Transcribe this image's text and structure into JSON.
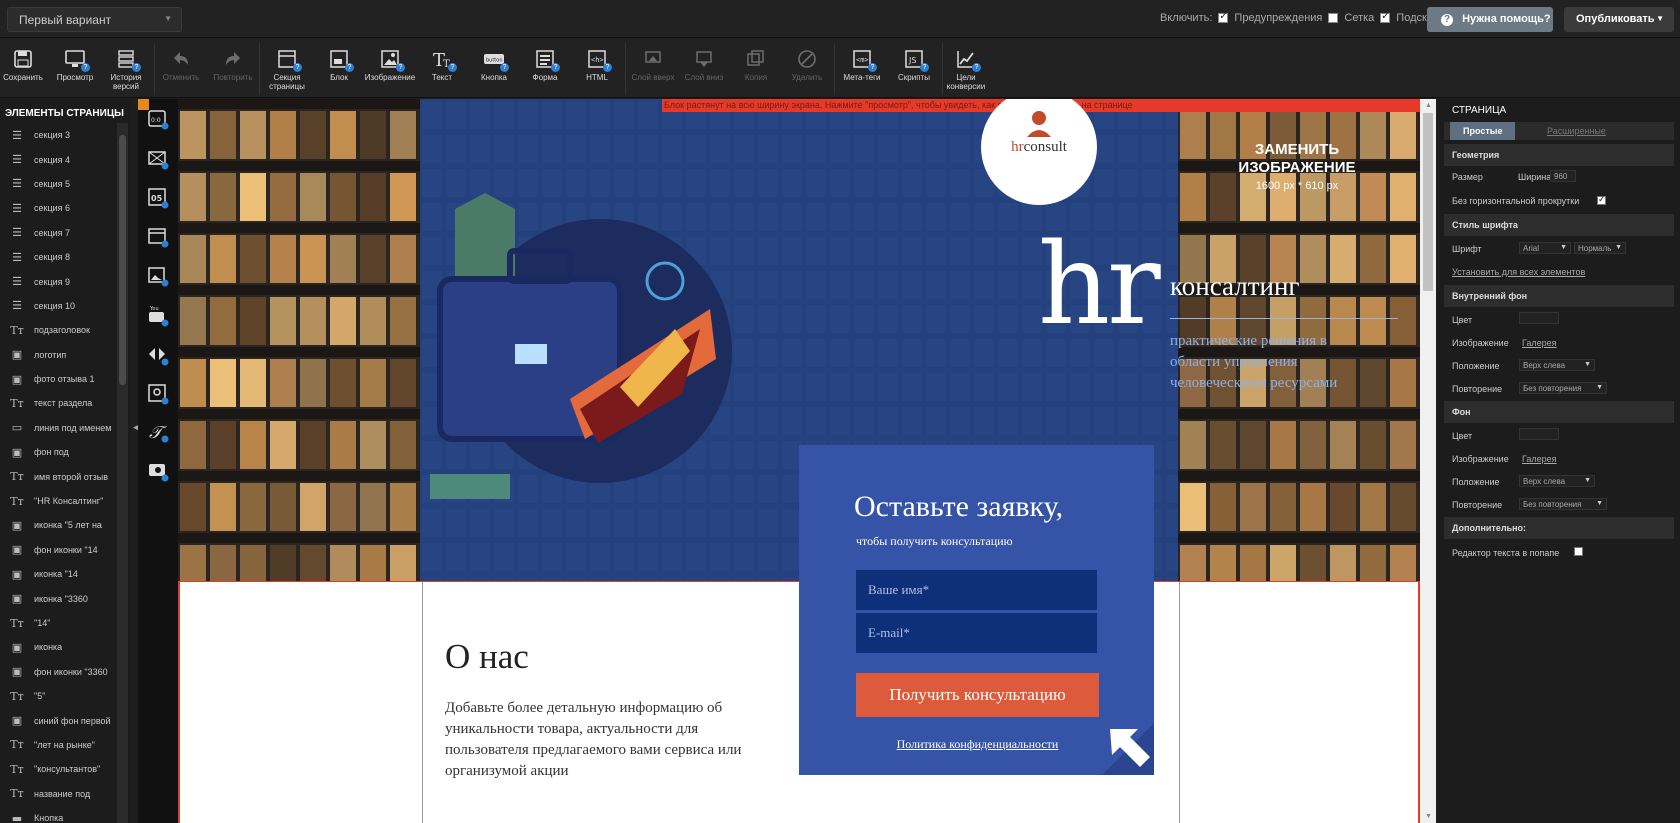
{
  "topbar": {
    "variant": "Первый вариант",
    "enable_label": "Включить:",
    "warnings_label": "Предупреждения",
    "grid_label": "Сетка",
    "hints_label": "Подсказки",
    "help_label": "Нужна помощь?",
    "publish_label": "Опубликовать"
  },
  "toolbar": {
    "save": "Сохранить",
    "preview": "Просмотр",
    "history": "История версий",
    "undo": "Отменить",
    "redo": "Повторить",
    "page_section": "Секция страницы",
    "block": "Блок",
    "image": "Изображение",
    "text": "Текст",
    "button": "Кнопка",
    "form": "Форма",
    "html": "HTML",
    "layer_up": "Слой вверх",
    "layer_down": "Слой вниз",
    "copy": "Копия",
    "delete": "Удалить",
    "meta_tags": "Мета-теги",
    "scripts": "Скрипты",
    "conversion_goals": "Цели конверсии"
  },
  "elements_panel": {
    "title": "ЭЛЕМЕНТЫ СТРАНИЦЫ",
    "items": [
      {
        "label": "секция 3",
        "icon": "section-icon"
      },
      {
        "label": "секция 4",
        "icon": "section-icon"
      },
      {
        "label": "секция 5",
        "icon": "section-icon"
      },
      {
        "label": "секция 6",
        "icon": "section-icon"
      },
      {
        "label": "секция 7",
        "icon": "section-icon"
      },
      {
        "label": "секция 8",
        "icon": "section-icon"
      },
      {
        "label": "секция 9",
        "icon": "section-icon"
      },
      {
        "label": "секция 10",
        "icon": "section-icon"
      },
      {
        "label": "подзаголовок",
        "icon": "text-icon"
      },
      {
        "label": "логотип",
        "icon": "image-icon"
      },
      {
        "label": "фото отзыва 1",
        "icon": "image-icon"
      },
      {
        "label": "текст раздела",
        "icon": "text-icon"
      },
      {
        "label": "линия под именем",
        "icon": "line-icon"
      },
      {
        "label": "фон под",
        "icon": "image-icon"
      },
      {
        "label": "имя второй отзыв",
        "icon": "text-icon"
      },
      {
        "label": "\"HR Консалтинг\"",
        "icon": "text-icon"
      },
      {
        "label": "иконка \"5 лет на",
        "icon": "image-icon"
      },
      {
        "label": "фон иконки \"14",
        "icon": "image-icon"
      },
      {
        "label": "иконка \"14",
        "icon": "image-icon"
      },
      {
        "label": "иконка \"3360",
        "icon": "image-icon"
      },
      {
        "label": "\"14\"",
        "icon": "text-icon"
      },
      {
        "label": "иконка",
        "icon": "image-icon"
      },
      {
        "label": "фон иконки \"3360",
        "icon": "image-icon"
      },
      {
        "label": "\"5\"",
        "icon": "text-icon"
      },
      {
        "label": "синий фон первой",
        "icon": "image-icon"
      },
      {
        "label": "\"лет на рынке\"",
        "icon": "text-icon"
      },
      {
        "label": "\"консультантов\"",
        "icon": "text-icon"
      },
      {
        "label": "название под",
        "icon": "text-icon"
      },
      {
        "label": "Кнопка",
        "icon": "button-icon"
      }
    ]
  },
  "canvas": {
    "full_width_notice": "Блок растянут на всю ширину экрана. Нажмите \"просмотр\", чтобы увидеть, как он будет выглядеть на странице",
    "logo_hr": "hr",
    "logo_consult": "consult",
    "replace_image_1": "ЗАМЕНИТЬ",
    "replace_image_2": "ИЗОБРАЖЕНИЕ",
    "replace_size": "1600 px * 610 px",
    "hr_big": "hr",
    "consulting": "консалтинг",
    "tagline": "практические решения в области управления человеческими ресурсами",
    "form_title": "Оставьте заявку,",
    "form_subtitle": "чтобы получить консультацию",
    "name_placeholder": "Ваше имя*",
    "email_placeholder": "E-mail*",
    "submit": "Получить консультацию",
    "privacy": "Политика конфиденциальности",
    "about_title": "О нас",
    "about_text": "Добавьте более детальную информацию об уникальности товара, актуальности для пользователя предлагаемого вами сервиса или организумой акции"
  },
  "right_panel": {
    "title": "СТРАНИЦА",
    "tab_simple": "Простые",
    "tab_advanced": "Расширенные",
    "geometry": "Геометрия",
    "size_label": "Размер",
    "width_label": "Ширина",
    "width_value": "960",
    "no_hscroll": "Без горизонтальной прокрутки",
    "font_style": "Стиль шрифта",
    "font_label": "Шрифт",
    "font_value": "Arial",
    "font_weight": "Нормаль",
    "apply_all": "Установить для всех элементов",
    "inner_bg": "Внутренний фон",
    "color_label": "Цвет",
    "image_label": "Изображение",
    "gallery": "Галерея",
    "position_label": "Положение",
    "position_value": "Верх слева",
    "repeat_label": "Повторение",
    "repeat_value": "Без повторения",
    "bg": "Фон",
    "color_label_2": "Цвет",
    "image_label_2": "Изображение",
    "gallery_2": "Галерея",
    "position_label_2": "Положение",
    "position_value_2": "Верх слева",
    "repeat_label_2": "Повторение",
    "repeat_value_2": "Без повторения",
    "extra": "Дополнительно:",
    "popup_editor": "Редактор текста в попапе"
  },
  "colors": {
    "hero_blue": "#2c4a86",
    "form_blue": "#3554a7",
    "cta_orange": "#dd5a3a",
    "accent_red": "#e53a2a",
    "help_button": "#6c7a86"
  }
}
